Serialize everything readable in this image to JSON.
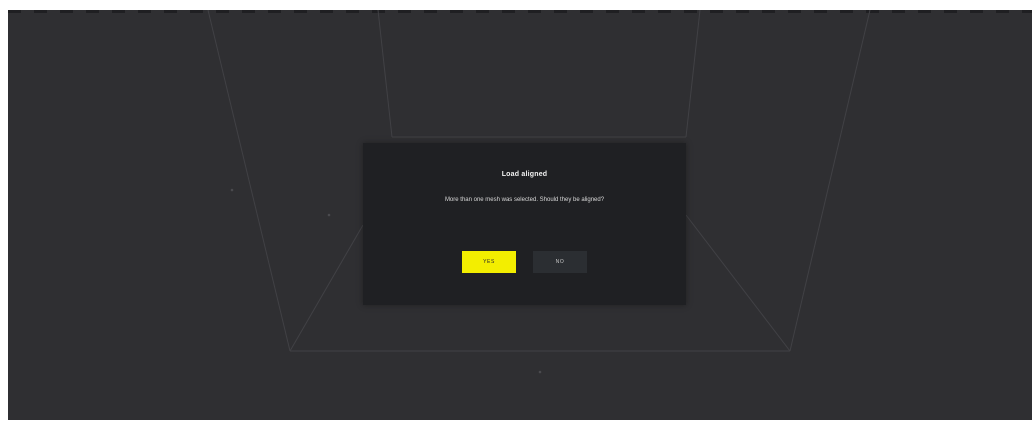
{
  "dialog": {
    "title": "Load aligned",
    "message": "More than one mesh was selected. Should they be aligned?",
    "yes_label": "YES",
    "no_label": "NO"
  },
  "colors": {
    "accent": "#f3ee00",
    "background": "#2f2f32",
    "dialog_background": "#1f2023"
  }
}
